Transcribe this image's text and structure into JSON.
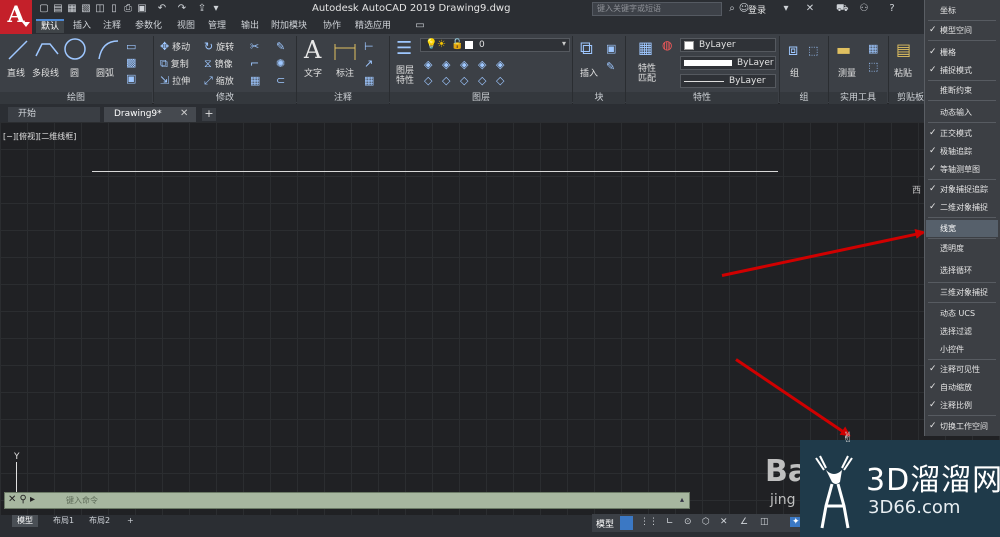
{
  "titlebar": {
    "app_title": "Autodesk AutoCAD 2019    Drawing9.dwg",
    "search_placeholder": "键入关键字或短语",
    "login_label": "登录"
  },
  "ribbon_tabs": [
    "默认",
    "插入",
    "注释",
    "参数化",
    "视图",
    "管理",
    "输出",
    "附加模块",
    "协作",
    "精选应用"
  ],
  "ribbon": {
    "draw": {
      "title": "绘图",
      "tools": [
        "直线",
        "多段线",
        "圆",
        "圆弧"
      ]
    },
    "modify": {
      "title": "修改",
      "tools": [
        "移动",
        "旋转",
        "复制",
        "镜像",
        "拉伸",
        "缩放"
      ]
    },
    "annotate": {
      "title": "注释",
      "tools": [
        "文字",
        "标注"
      ]
    },
    "layers": {
      "title": "图层",
      "tool": "图层特性",
      "current": "0"
    },
    "block": {
      "title": "块",
      "tool": "插入"
    },
    "properties": {
      "title": "特性",
      "tool": "特性匹配",
      "color": "ByLayer",
      "linetype": "ByLayer",
      "lineweight": "ByLayer"
    },
    "groups": {
      "title": "组",
      "tool": "组"
    },
    "utilities": {
      "title": "实用工具",
      "tool": "测量"
    },
    "clipboard": {
      "title": "剪贴板",
      "tool": "粘贴"
    }
  },
  "file_tabs": {
    "start": "开始",
    "drawing": "Drawing9*"
  },
  "canvas": {
    "viewport_label": "[−][俯视][二维线框]",
    "ucs_y": "Y",
    "view_cube_label": "西"
  },
  "command_line": {
    "prompt": "键入命令"
  },
  "layout_tabs": [
    "模型",
    "布局1",
    "布局2"
  ],
  "status": {
    "model": "模型"
  },
  "menu": {
    "items": [
      {
        "label": "坐标",
        "checked": false
      },
      {
        "label": "模型空间",
        "checked": true
      },
      {
        "label": "栅格",
        "checked": true
      },
      {
        "label": "捕捉模式",
        "checked": true
      },
      {
        "label": "推断约束",
        "checked": false
      },
      {
        "label": "动态输入",
        "checked": false
      },
      {
        "label": "正交模式",
        "checked": true
      },
      {
        "label": "极轴追踪",
        "checked": true
      },
      {
        "label": "等轴测草图",
        "checked": true
      },
      {
        "label": "对象捕捉追踪",
        "checked": true
      },
      {
        "label": "二维对象捕捉",
        "checked": true
      },
      {
        "label": "线宽",
        "checked": false,
        "highlighted": true
      },
      {
        "label": "透明度",
        "checked": false
      },
      {
        "label": "选择循环",
        "checked": false
      },
      {
        "label": "三维对象捕捉",
        "checked": false
      },
      {
        "label": "动态 UCS",
        "checked": false
      },
      {
        "label": "选择过滤",
        "checked": false
      },
      {
        "label": "小控件",
        "checked": false
      },
      {
        "label": "注释可见性",
        "checked": true
      },
      {
        "label": "自动缩放",
        "checked": true
      },
      {
        "label": "注释比例",
        "checked": true
      },
      {
        "label": "切换工作空间",
        "checked": true
      }
    ]
  },
  "watermark": {
    "brand_cn": "3D溜溜网",
    "brand_url": "3D66.com",
    "baidu": "Bai",
    "baidu_sub": "jing"
  },
  "colors": {
    "accent": "#3b78c4",
    "arrow": "#d00000",
    "autocad_red": "#c4202a",
    "command_bg": "#a7b7a0"
  }
}
